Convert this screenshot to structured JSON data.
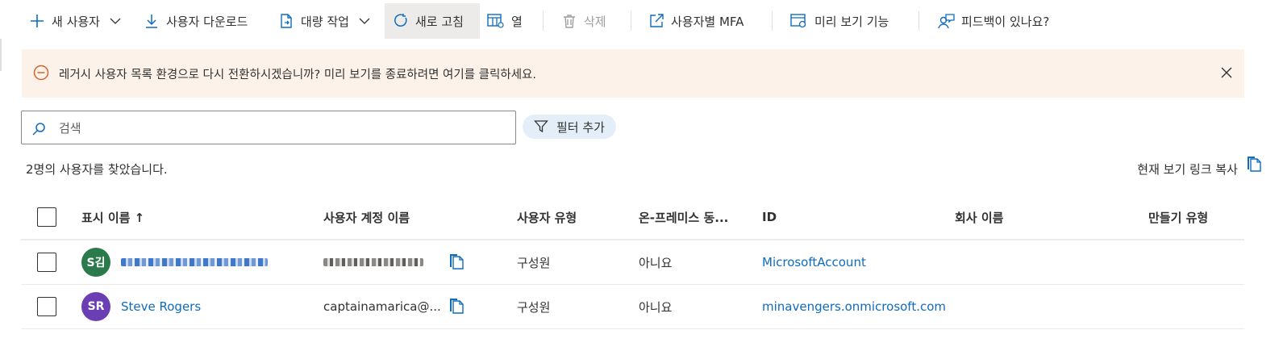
{
  "toolbar": {
    "new_user": "새 사용자",
    "download_users": "사용자 다운로드",
    "bulk_operations": "대량 작업",
    "refresh": "새로 고침",
    "columns": "열",
    "delete": "삭제",
    "per_user_mfa": "사용자별 MFA",
    "preview_features": "미리 보기 기능",
    "feedback": "피드백이 있나요?"
  },
  "banner": {
    "message": "레거시 사용자 목록 환경으로 다시 전환하시겠습니까? 미리 보기를 종료하려면 여기를 클릭하세요."
  },
  "search": {
    "placeholder": "검색"
  },
  "filter": {
    "label": "필터 추가"
  },
  "results": {
    "count_text": "2명의 사용자를 찾았습니다."
  },
  "copy_link": {
    "label": "현재 보기 링크 복사"
  },
  "table": {
    "columns": {
      "display_name": "표시 이름 ↑",
      "upn": "사용자 계정 이름",
      "user_type": "사용자 유형",
      "on_prem_sync": "온-프레미스 동...",
      "identities": "ID",
      "company_name": "회사 이름",
      "creation_type": "만들기 유형"
    },
    "rows": [
      {
        "initials": "S김",
        "avatar_color": "#2b7a4b",
        "display_name": "",
        "upn": "",
        "user_type": "구성원",
        "on_prem_sync": "아니요",
        "identity": "MicrosoftAccount"
      },
      {
        "initials": "SR",
        "avatar_color": "#6b3fb3",
        "display_name": "Steve Rogers",
        "upn": "captainamarica@...",
        "user_type": "구성원",
        "on_prem_sync": "아니요",
        "identity": "minavengers.onmicrosoft.com"
      }
    ]
  },
  "colors": {
    "accent": "#0f6cbd",
    "banner_bg": "#fdf2ea",
    "warning": "#d1642a",
    "filter_bg": "#e4eef9"
  }
}
